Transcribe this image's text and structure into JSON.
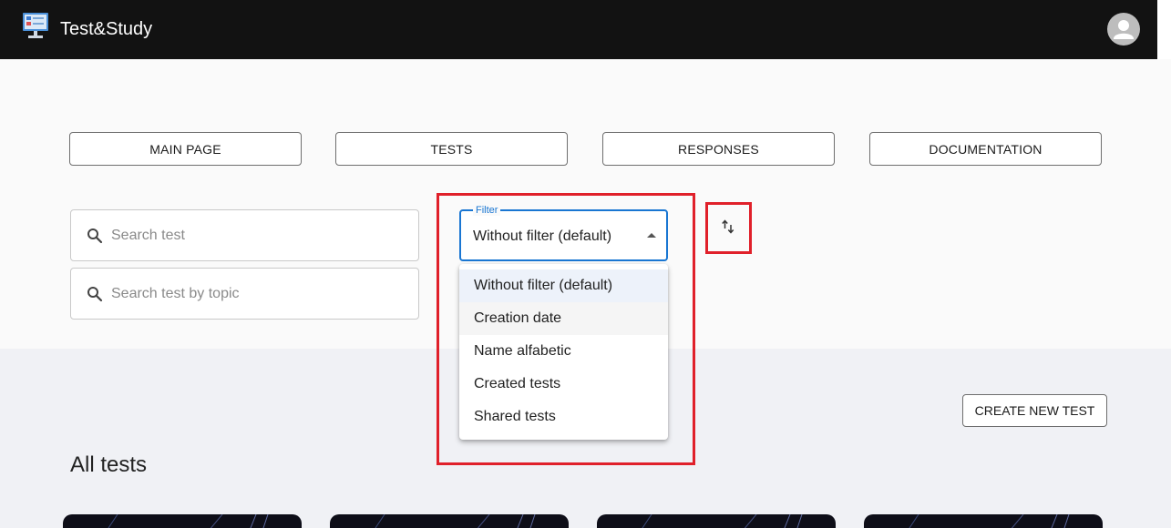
{
  "app": {
    "title": "Test&Study"
  },
  "icons": {
    "logo": "computer-quiz-logo",
    "avatar": "user-avatar-icon",
    "search": "search-icon",
    "sort": "sort-arrows-icon",
    "caret": "caret-up-icon"
  },
  "nav": {
    "items": [
      "MAIN PAGE",
      "TESTS",
      "RESPONSES",
      "DOCUMENTATION"
    ]
  },
  "search": {
    "placeholder": "Search test",
    "topic_placeholder": "Search test by topic"
  },
  "filter": {
    "label": "Filter",
    "value": "Without filter (default)",
    "options": [
      "Without filter (default)",
      "Creation date",
      "Name alfabetic",
      "Created tests",
      "Shared tests"
    ],
    "selected_index": 0,
    "hovered_index": 1
  },
  "actions": {
    "create_label": "CREATE NEW TEST"
  },
  "section": {
    "title": "All tests"
  },
  "colors": {
    "appbar": "#121212",
    "accent": "#1976d2",
    "highlight": "#e0202a",
    "lower_bg": "#f0f1f5"
  }
}
